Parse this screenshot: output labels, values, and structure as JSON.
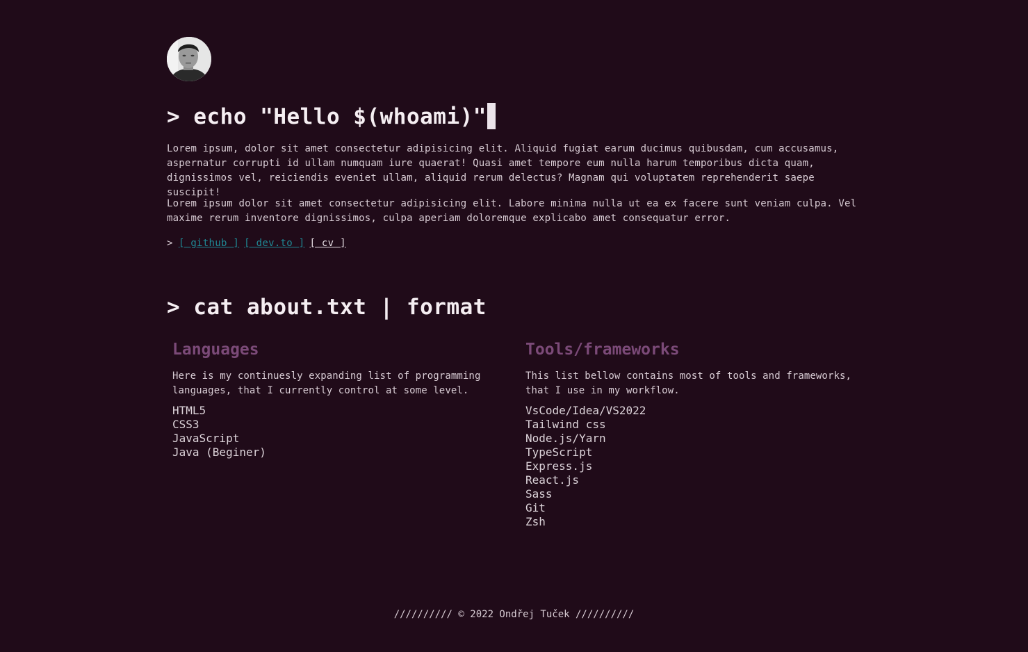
{
  "hero": {
    "command_prompt": ">",
    "command_text": "echo \"Hello $(whoami)\"",
    "paragraphs": [
      "Lorem ipsum, dolor sit amet consectetur adipisicing elit. Aliquid fugiat earum ducimus quibusdam, cum accusamus, aspernatur corrupti id ullam numquam iure quaerat! Quasi amet tempore eum nulla harum temporibus dicta quam, dignissimos vel, reiciendis eveniet ullam, aliquid rerum delectus? Magnam qui voluptatem reprehenderit saepe suscipit!",
      "Lorem ipsum dolor sit amet consectetur adipisicing elit. Labore minima nulla ut ea ex facere sunt veniam culpa. Vel maxime rerum inventore dignissimos, culpa aperiam doloremque explicabo amet consequatur error."
    ],
    "links_prompt": ">",
    "links": [
      {
        "label": "[ github ]"
      },
      {
        "label": "[ dev.to ]"
      },
      {
        "label": "[ cv ]"
      }
    ]
  },
  "about": {
    "command_prompt": ">",
    "command_text": "cat about.txt | format",
    "languages": {
      "title": "Languages",
      "description": "Here is my continuesly expanding list of programming languages, that I currently control at some level.",
      "items": [
        "HTML5",
        "CSS3",
        "JavaScript",
        "Java (Beginer)"
      ]
    },
    "tools": {
      "title": "Tools/frameworks",
      "description": "This list bellow contains most of tools and frameworks, that I use in my workflow.",
      "items": [
        "VsCode/Idea/VS2022",
        "Tailwind css",
        "Node.js/Yarn",
        "TypeScript",
        "Express.js",
        "React.js",
        "Sass",
        "Git",
        "Zsh"
      ]
    }
  },
  "footer": {
    "text": "////////// © 2022 Ondřej Tuček //////////"
  },
  "colors": {
    "background": "#200b19",
    "heading_accent": "#7b4a78",
    "link_accent": "#1f8a96"
  }
}
